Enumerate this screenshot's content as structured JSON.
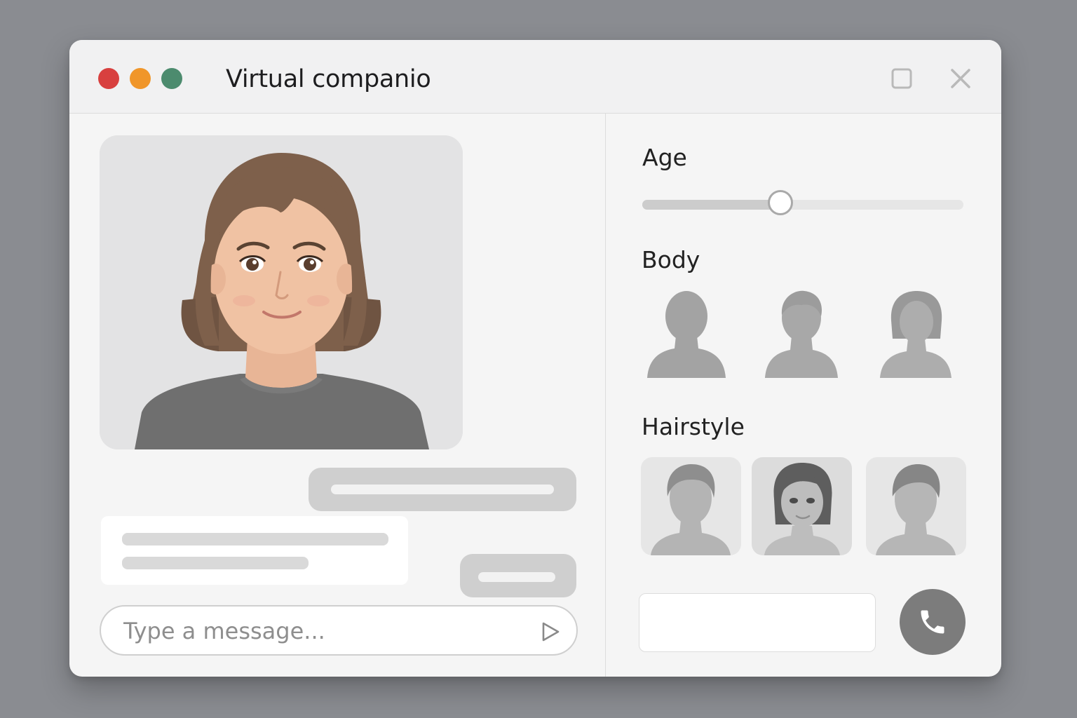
{
  "window": {
    "title": "Virtual companio",
    "controls": {
      "close_color": "#d8403f",
      "minimize_color": "#f0962a",
      "zoom_color": "#4c8b6e"
    }
  },
  "chat": {
    "input_placeholder": "Type a message..."
  },
  "settings": {
    "age_label": "Age",
    "age_level": 0.43,
    "body_label": "Body",
    "body_options": [
      "male-silhouette-icon",
      "short-hair-silhouette-icon",
      "bob-hair-silhouette-icon"
    ],
    "hairstyle_label": "Hairstyle",
    "hairstyle_options": [
      "short-male-hair-icon",
      "bob-female-hair-icon",
      "short-male-hair-2-icon"
    ],
    "hairstyle_selected_index": 1
  },
  "colors": {
    "accent_gray": "#7c7c7c",
    "bubble_gray": "#cfcfcf",
    "background": "#8a8c91"
  }
}
